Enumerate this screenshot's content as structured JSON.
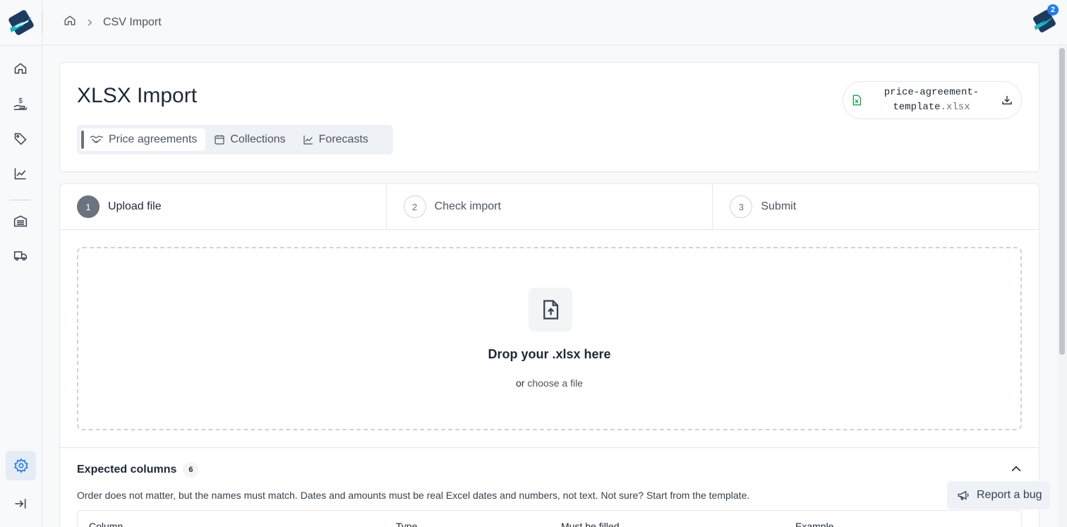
{
  "app": {
    "name": "Logo"
  },
  "header": {
    "breadcrumb": {
      "home": "home-icon",
      "current": "CSV Import"
    },
    "notification_count": "2"
  },
  "sidebar": {
    "items": [
      {
        "name": "home",
        "icon": "home-icon"
      },
      {
        "name": "pricing",
        "icon": "hand-coin-icon"
      },
      {
        "name": "tags",
        "icon": "tag-icon"
      },
      {
        "name": "analytics",
        "icon": "chart-line-icon"
      },
      {
        "name": "warehouse",
        "icon": "warehouse-icon"
      },
      {
        "name": "delivery",
        "icon": "truck-icon"
      },
      {
        "name": "settings",
        "icon": "gear-icon",
        "active": true
      },
      {
        "name": "collapse",
        "icon": "arrow-right-bar-icon"
      }
    ]
  },
  "page": {
    "title": "XLSX Import",
    "tabs": [
      {
        "label": "Price agreements",
        "icon": "handshake-icon",
        "active": true
      },
      {
        "label": "Collections",
        "icon": "calendar-icon"
      },
      {
        "label": "Forecasts",
        "icon": "chart-line-icon"
      }
    ],
    "template": {
      "name": "price-agreement-",
      "name2": "template",
      "ext": ".xlsx"
    }
  },
  "steps": [
    {
      "num": "1",
      "label": "Upload file",
      "active": true
    },
    {
      "num": "2",
      "label": "Check import"
    },
    {
      "num": "3",
      "label": "Submit"
    }
  ],
  "dropzone": {
    "title": "Drop your .xlsx here",
    "prefix": "or",
    "link": "choose a file"
  },
  "expected": {
    "title": "Expected columns",
    "count": "6",
    "description": "Order does not matter, but the names must match. Dates and amounts must be real Excel dates and numbers, not text. Not sure? Start from the template.",
    "headers": [
      "Column",
      "Type",
      "Must be filled",
      "Example"
    ]
  },
  "report_bug": {
    "label": "Report a bug"
  },
  "colors": {
    "accent": "#1d7ce8",
    "brand": "#17b8c4",
    "excel_green": "#16a34a"
  }
}
